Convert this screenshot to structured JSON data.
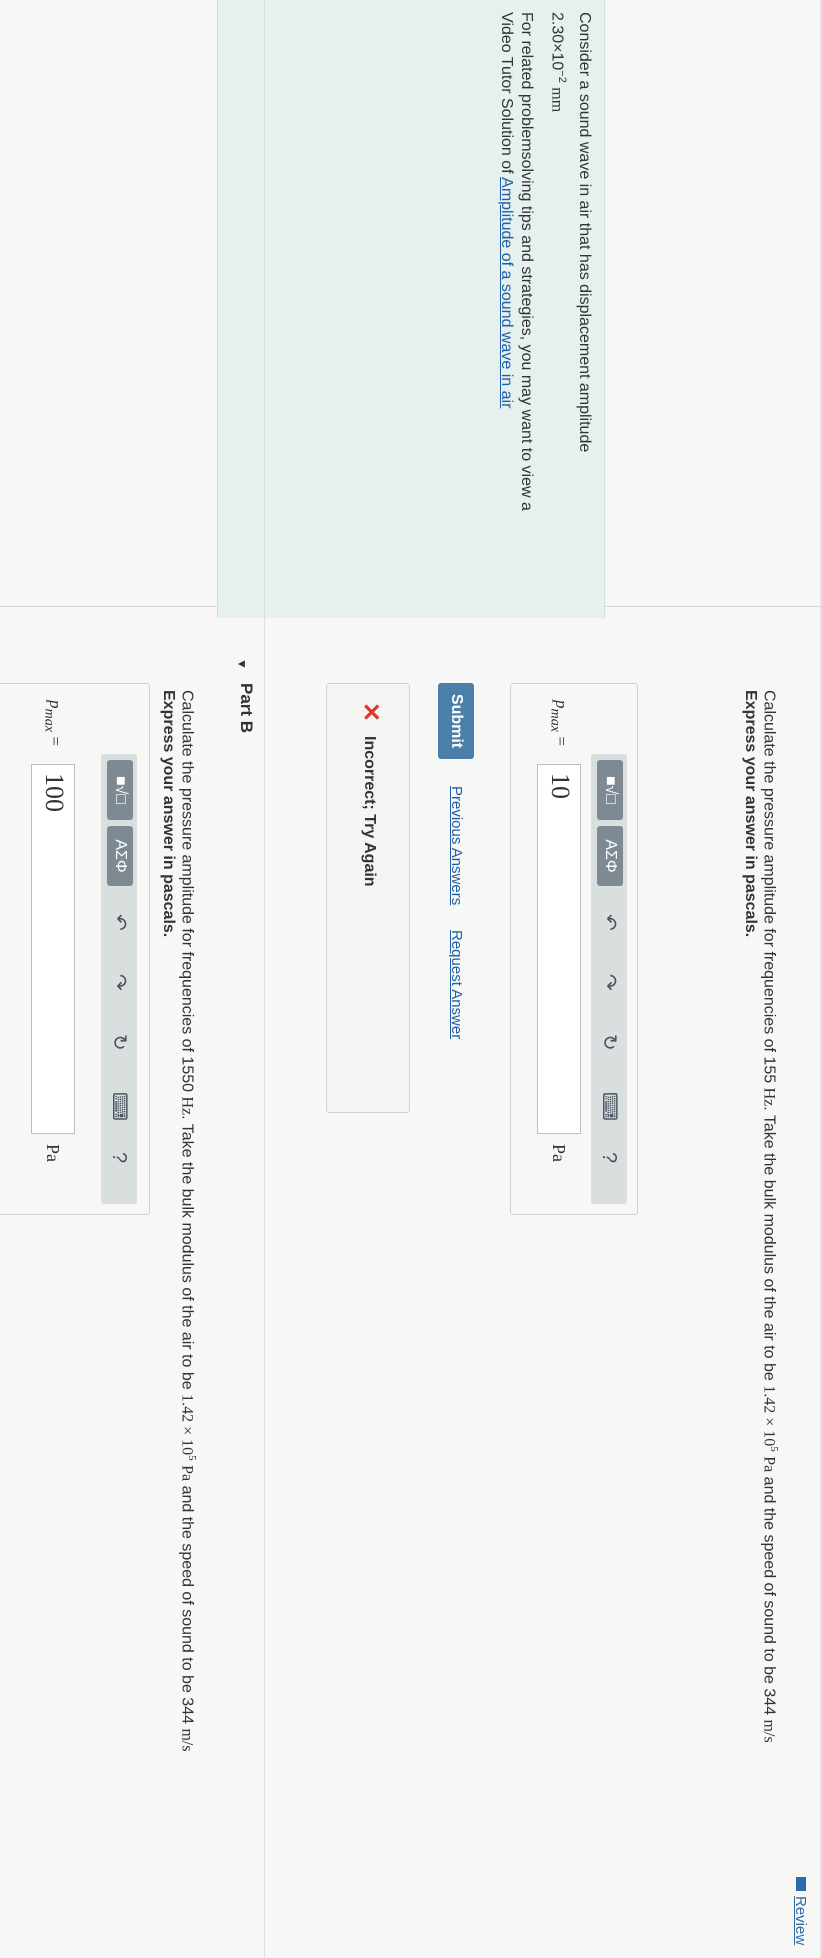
{
  "review": {
    "label": "Review"
  },
  "intro": {
    "line1": "Consider a sound wave in air that has displacement amplitude",
    "amplitude": "2.30×10",
    "amplitude_exp": "−2",
    "amplitude_unit": "mm",
    "help_line1": "For related problemsolving tips and strategies, you may want to view a",
    "help_line2_prefix": "Video Tutor Solution of ",
    "help_link": "Amplitude of a sound wave in air"
  },
  "partA": {
    "question_prefix": "Calculate the pressure amplitude for frequencies of 155",
    "question_freq_unit": "Hz",
    "question_mid": ". Take the bulk modulus of the air to be",
    "question_modulus": "1.42 × 10",
    "question_modulus_exp": "5",
    "question_modulus_unit": "Pa",
    "question_suffix": "and the speed of sound to be 344",
    "question_speed_unit": "m/s",
    "instruction": "Express your answer in pascals.",
    "var_label": "p",
    "var_sub": "max",
    "equals": "=",
    "value": "10",
    "unit": "Pa",
    "submit_label": "Submit",
    "previous_answers": "Previous Answers",
    "request_answer": "Request Answer",
    "feedback": "Incorrect; Try Again"
  },
  "partB": {
    "title": "Part B",
    "question_prefix": "Calculate the pressure amplitude for frequencies of 1550",
    "question_freq_unit": "Hz",
    "question_mid": ". Take the bulk modulus of the air to be",
    "question_modulus": "1.42 × 10",
    "question_modulus_exp": "5",
    "question_modulus_unit": "Pa",
    "question_suffix": "and the speed of sound to be 344",
    "question_speed_unit": "m/s",
    "instruction": "Express your answer in pascals.",
    "var_label": "p",
    "var_sub": "max",
    "equals": "=",
    "value": "100",
    "unit": "Pa"
  },
  "toolbar": {
    "templates_icon": "templates-icon",
    "greek_label": "ΑΣΦ",
    "undo_icon": "undo-icon",
    "redo_icon": "redo-icon",
    "reset_icon": "reset-icon",
    "keyboard_icon": "keyboard-icon",
    "help_label": "?"
  },
  "colors": {
    "accent": "#4b7ea8",
    "link": "#1f5fa8",
    "error": "#d83a2b",
    "panel": "#e6f0ee"
  }
}
